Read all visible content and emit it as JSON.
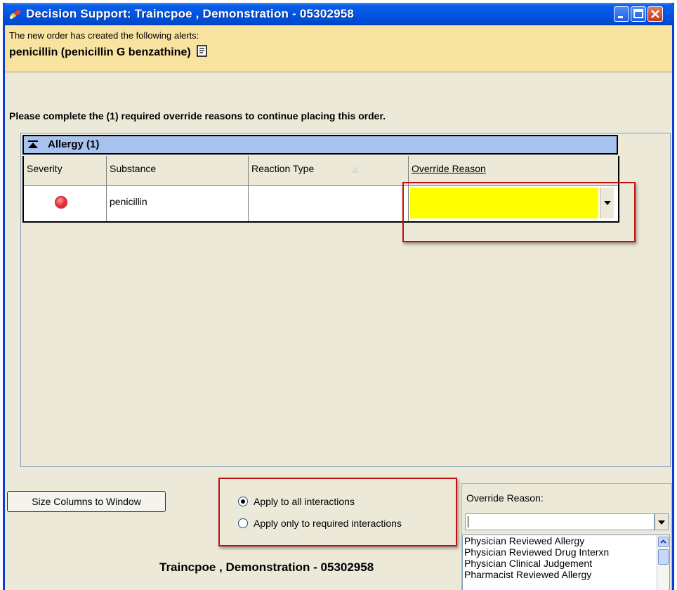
{
  "window": {
    "title": "Decision Support: Traincpoe , Demonstration - 05302958",
    "icon": "pills-icon"
  },
  "alert": {
    "intro": "The new order has created the following alerts:",
    "drug": "penicillin (penicillin G benzathine)"
  },
  "instruction": "Please complete the (1) required override reasons to continue placing this order.",
  "group": {
    "label": "Allergy (1)"
  },
  "table": {
    "columns": [
      "Severity",
      "Substance",
      "Reaction Type",
      "Override Reason"
    ],
    "rows": [
      {
        "severity": "high",
        "substance": "penicillin",
        "reaction_type": "",
        "override_reason": ""
      }
    ]
  },
  "colors": {
    "required_field": "#ffff00",
    "highlight": "#c01010",
    "alert_panel": "#f8e3a0",
    "group_header": "#a8c2f0"
  },
  "controls": {
    "size_columns_button": "Size Columns to Window",
    "radio_all": "Apply to all interactions",
    "radio_required": "Apply only to required interactions",
    "radio_selected": "all"
  },
  "override": {
    "label": "Override Reason:",
    "value": "",
    "options": [
      "Physician Reviewed Allergy",
      "Physician Reviewed Drug Interxn",
      "Physician Clinical Judgement",
      "Pharmacist Reviewed Allergy"
    ]
  },
  "footer": {
    "patient": "Traincpoe , Demonstration - 05302958"
  }
}
